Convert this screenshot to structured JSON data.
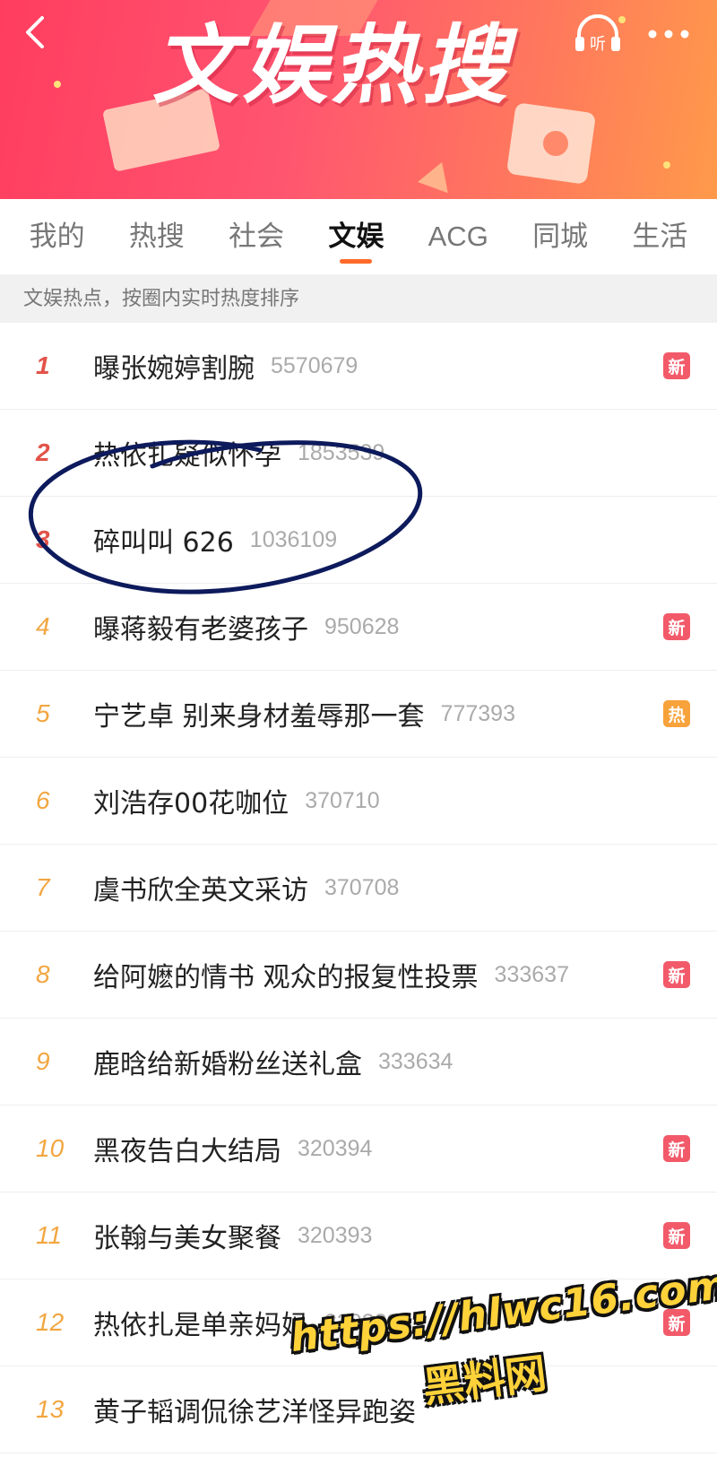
{
  "header": {
    "title": "文娱热搜",
    "back_icon": "chevron-left-icon",
    "listen_label": "听",
    "listen_icon": "headphones-icon",
    "more_icon": "more-dots-icon",
    "gradient_colors": [
      "#ff3d5f",
      "#ff7a5c",
      "#ff9a4a"
    ]
  },
  "tabs": [
    {
      "label": "我的",
      "active": false
    },
    {
      "label": "热搜",
      "active": false
    },
    {
      "label": "社会",
      "active": false
    },
    {
      "label": "文娱",
      "active": true
    },
    {
      "label": "ACG",
      "active": false
    },
    {
      "label": "同城",
      "active": false
    },
    {
      "label": "生活",
      "active": false
    }
  ],
  "subheader": "文娱热点，按圈内实时热度排序",
  "items": [
    {
      "rank": "1",
      "title": "曝张婉婷割腕",
      "heat": "5570679",
      "badge": "新"
    },
    {
      "rank": "2",
      "title": "热依扎疑似怀孕",
      "heat": "1853539",
      "badge": ""
    },
    {
      "rank": "3",
      "title": "碎叫叫 626",
      "heat": "1036109",
      "badge": ""
    },
    {
      "rank": "4",
      "title": "曝蒋毅有老婆孩子",
      "heat": "950628",
      "badge": "新"
    },
    {
      "rank": "5",
      "title": "宁艺卓 别来身材羞辱那一套",
      "heat": "777393",
      "badge": "热"
    },
    {
      "rank": "6",
      "title": "刘浩存00花咖位",
      "heat": "370710",
      "badge": ""
    },
    {
      "rank": "7",
      "title": "虞书欣全英文采访",
      "heat": "370708",
      "badge": ""
    },
    {
      "rank": "8",
      "title": "给阿嬷的情书 观众的报复性投票",
      "heat": "333637",
      "badge": "新"
    },
    {
      "rank": "9",
      "title": "鹿晗给新婚粉丝送礼盒",
      "heat": "333634",
      "badge": ""
    },
    {
      "rank": "10",
      "title": "黑夜告白大结局",
      "heat": "320394",
      "badge": "新"
    },
    {
      "rank": "11",
      "title": "张翰与美女聚餐",
      "heat": "320393",
      "badge": "新"
    },
    {
      "rank": "12",
      "title": "热依扎是单亲妈妈",
      "heat": "320389",
      "badge": "新"
    },
    {
      "rank": "13",
      "title": "黄子韬调侃徐艺洋怪异跑姿",
      "heat": "",
      "badge": ""
    }
  ],
  "badge_colors": {
    "新": "#f25a6a",
    "热": "#f7a23a"
  },
  "annotation": {
    "color": "#0d1a5c",
    "circled_rank": "3"
  },
  "watermark": {
    "url": "https://hlwc16.com",
    "name": "黑料网"
  }
}
